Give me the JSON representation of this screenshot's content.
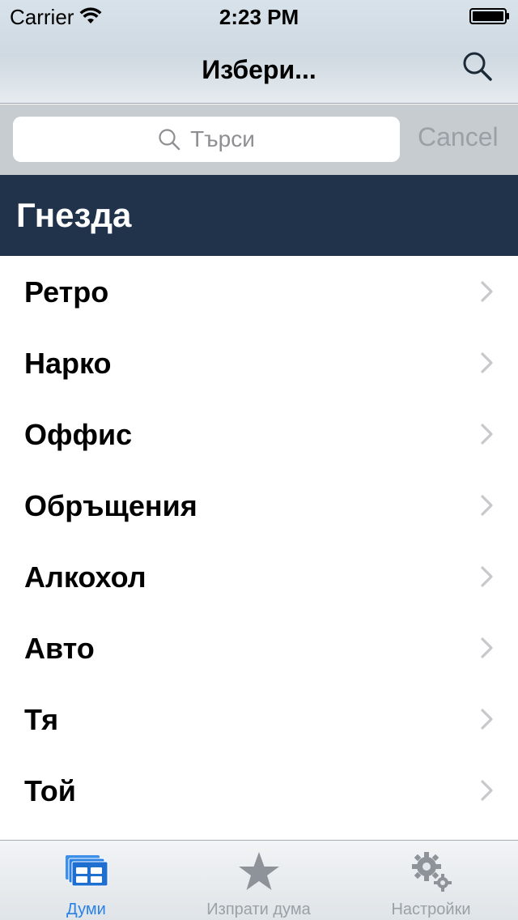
{
  "status_bar": {
    "carrier": "Carrier",
    "time": "2:23 PM"
  },
  "nav": {
    "title": "Избери...",
    "search_icon": "search-icon"
  },
  "search": {
    "placeholder": "Търси",
    "cancel_label": "Cancel"
  },
  "section": {
    "title": "Гнезда"
  },
  "list": {
    "items": [
      {
        "label": "Ретро"
      },
      {
        "label": "Нарко"
      },
      {
        "label": "Оффис"
      },
      {
        "label": "Обръщения"
      },
      {
        "label": "Алкохол"
      },
      {
        "label": "Авто"
      },
      {
        "label": "Тя"
      },
      {
        "label": "Той"
      }
    ]
  },
  "tabbar": {
    "tabs": [
      {
        "label": "Думи",
        "icon": "words-icon",
        "active": true
      },
      {
        "label": "Изпрати дума",
        "icon": "star-icon",
        "active": false
      },
      {
        "label": "Настройки",
        "icon": "gears-icon",
        "active": false
      }
    ]
  },
  "colors": {
    "section_header_bg": "#20334b",
    "tab_active": "#2a82e4",
    "tab_inactive": "#9aa0a6"
  }
}
